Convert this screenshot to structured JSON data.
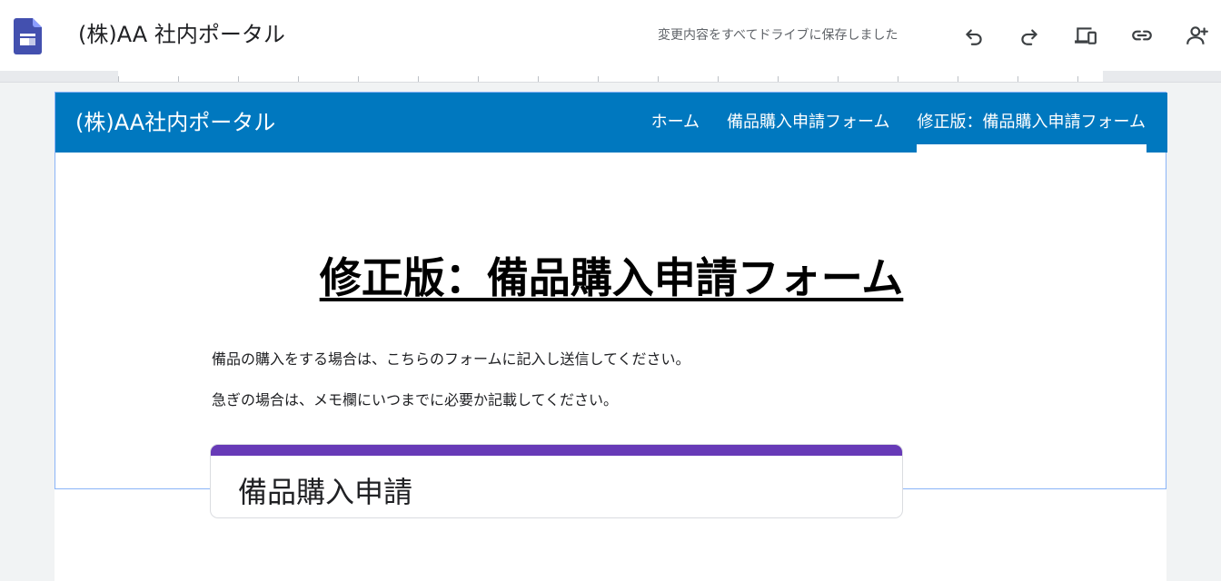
{
  "app": {
    "title": "(株)AA 社内ポータル",
    "save_status": "変更内容をすべてドライブに保存しました",
    "icons": [
      "sites-logo-icon",
      "undo-icon",
      "redo-icon",
      "preview-devices-icon",
      "link-icon",
      "add-person-icon"
    ],
    "brand_color": "#4350af"
  },
  "site": {
    "name": "(株)AA社内ポータル",
    "header_color": "#0078bf",
    "nav": [
      {
        "label": "ホーム"
      },
      {
        "label": "備品購入申請フォーム"
      },
      {
        "label": "修正版：備品購入申請フォーム",
        "active": true
      }
    ]
  },
  "content": {
    "heading": "修正版：備品購入申請フォーム",
    "paragraphs": [
      "備品の購入をする場合は、こちらのフォームに記入し送信してください。",
      "急ぎの場合は、メモ欄にいつまでに必要か記載してください。"
    ]
  },
  "form": {
    "title": "備品購入申請",
    "accent_color": "#673ab7"
  }
}
